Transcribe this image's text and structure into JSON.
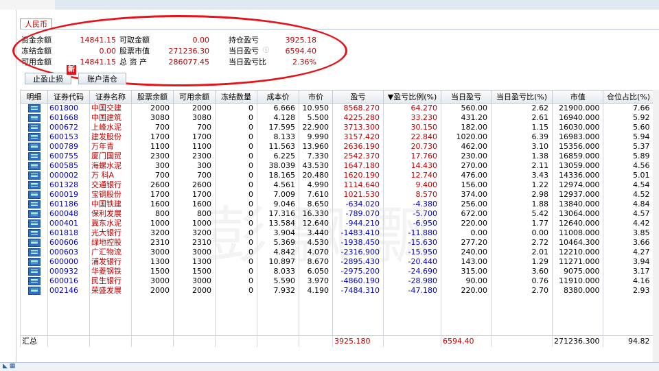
{
  "currency_tab": "人民币",
  "summary": {
    "row1": [
      {
        "label": "资金余额",
        "value": "14841.15"
      },
      {
        "label": "可取金额",
        "value": "0.00"
      },
      {
        "label": "持仓盈亏",
        "value": "3925.18"
      }
    ],
    "row2": [
      {
        "label": "冻结金额",
        "value": "0.00"
      },
      {
        "label": "股票市值",
        "value": "271236.30"
      },
      {
        "label": "当日盈亏",
        "value": "6594.40"
      }
    ],
    "row3": [
      {
        "label": "可用金额",
        "value": "14841.15"
      },
      {
        "label": "总 资 产",
        "value": "286077.45"
      },
      {
        "label": "当日盈亏比",
        "value": "2.36%"
      }
    ],
    "info_icon": "info-icon"
  },
  "buttons": {
    "stop_profit_loss": "止盈止损",
    "new_badge": "新",
    "clear_account": "账户清仓"
  },
  "colors": {
    "accent_red": "#c00000",
    "code_blue": "#0000cc",
    "annotation_red": "#e3151a"
  },
  "watermark": "彭飘飘",
  "table": {
    "headers": [
      "明细",
      "证券代码",
      "证券名称",
      "股票余额",
      "可用余额",
      "冻结数量",
      "成本价",
      "市价",
      "盈亏",
      "▼盈亏比例(%)",
      "当日盈亏",
      "当日盈亏比(%)",
      "市值",
      "仓位占比(%)"
    ],
    "rows": [
      [
        "600016",
        "民生银行",
        "3000",
        "3000",
        "0",
        "5.590",
        "3.970",
        "-4860.190",
        "-28.980",
        "90.00",
        "0.76",
        "11910.000",
        "4.16"
      ],
      [
        "601800",
        "中国交建",
        "2000",
        "2000",
        "0",
        "6.666",
        "10.950",
        "8568.270",
        "64.270",
        "560.00",
        "2.62",
        "21900.000",
        "7.66"
      ],
      [
        "601668",
        "中国建筑",
        "3080",
        "3080",
        "0",
        "4.128",
        "5.500",
        "4225.280",
        "33.230",
        "431.20",
        "2.61",
        "16940.000",
        "5.92"
      ],
      [
        "000672",
        "上峰水泥",
        "700",
        "700",
        "0",
        "17.595",
        "22.900",
        "3713.300",
        "30.150",
        "182.00",
        "1.15",
        "16030.000",
        "5.60"
      ],
      [
        "600153",
        "建发股份",
        "1700",
        "1700",
        "0",
        "8.133",
        "9.990",
        "3157.420",
        "22.840",
        "1020.00",
        "6.39",
        "16983.000",
        "5.94"
      ],
      [
        "000789",
        "万年青",
        "1100",
        "1100",
        "0",
        "11.563",
        "13.960",
        "2636.190",
        "20.730",
        "462.00",
        "3.10",
        "15356.000",
        "5.37"
      ],
      [
        "600755",
        "厦门国贸",
        "2300",
        "2300",
        "0",
        "6.225",
        "7.330",
        "2542.370",
        "17.760",
        "230.00",
        "1.38",
        "16859.000",
        "5.89"
      ],
      [
        "600585",
        "海螺水泥",
        "300",
        "300",
        "0",
        "38.039",
        "43.530",
        "1647.180",
        "14.430",
        "270.00",
        "2.11",
        "13059.000",
        "4.56"
      ],
      [
        "000002",
        "万 科A",
        "700",
        "700",
        "0",
        "18.165",
        "20.480",
        "1620.190",
        "12.740",
        "476.00",
        "3.43",
        "14336.000",
        "5.01"
      ],
      [
        "601328",
        "交通银行",
        "2600",
        "2600",
        "0",
        "4.561",
        "4.990",
        "1114.640",
        "9.400",
        "156.00",
        "1.22",
        "12974.000",
        "4.54"
      ],
      [
        "600019",
        "宝钢股份",
        "1700",
        "1700",
        "0",
        "7.009",
        "7.610",
        "1021.530",
        "8.570",
        "374.00",
        "2.98",
        "12937.000",
        "4.52"
      ],
      [
        "601186",
        "中国铁建",
        "1600",
        "1600",
        "0",
        "9.046",
        "8.650",
        "-634.020",
        "-4.380",
        "256.00",
        "1.88",
        "13840.000",
        "4.84"
      ],
      [
        "600048",
        "保利发展",
        "800",
        "800",
        "0",
        "17.316",
        "16.330",
        "-789.070",
        "-5.700",
        "672.00",
        "5.42",
        "13064.000",
        "4.57"
      ],
      [
        "000401",
        "冀东水泥",
        "1000",
        "1000",
        "0",
        "13.584",
        "12.640",
        "-944.210",
        "-6.950",
        "220.00",
        "1.77",
        "12640.000",
        "4.42"
      ],
      [
        "601818",
        "光大银行",
        "3200",
        "3200",
        "0",
        "3.904",
        "3.440",
        "-1483.410",
        "-11.880",
        "0.00",
        "0.00",
        "11008.000",
        "3.85"
      ],
      [
        "600606",
        "绿地控股",
        "2310",
        "2310",
        "0",
        "5.369",
        "4.530",
        "-1938.450",
        "-15.630",
        "277.20",
        "2.72",
        "10464.300",
        "3.66"
      ],
      [
        "000603",
        "广汇物流",
        "3000",
        "3000",
        "0",
        "4.842",
        "4.070",
        "-2316.900",
        "-15.950",
        "240.00",
        "2.01",
        "12210.000",
        "4.27"
      ],
      [
        "600000",
        "浦发银行",
        "1300",
        "1300",
        "0",
        "10.897",
        "8.670",
        "-2895.430",
        "-20.440",
        "143.00",
        "1.29",
        "11271.000",
        "3.94"
      ],
      [
        "000932",
        "华菱钢铁",
        "1500",
        "1500",
        "0",
        "8.033",
        "6.050",
        "-2975.200",
        "-24.690",
        "315.00",
        "3.60",
        "9075.000",
        "3.17"
      ],
      [
        "600016",
        "民生银行",
        "3000",
        "3000",
        "0",
        "5.590",
        "3.970",
        "-4860.190",
        "-28.980",
        "90.00",
        "0.76",
        "11910.000",
        "4.16"
      ],
      [
        "002146",
        "荣盛发展",
        "2000",
        "2000",
        "0",
        "7.932",
        "4.190",
        "-7484.310",
        "-47.180",
        "220.00",
        "2.70",
        "8380.000",
        "2.93"
      ]
    ],
    "total": {
      "label": "汇总",
      "pnl": "3925.180",
      "day_pnl": "6594.40",
      "market_value": "271236.300",
      "position_ratio": "94.82"
    }
  }
}
